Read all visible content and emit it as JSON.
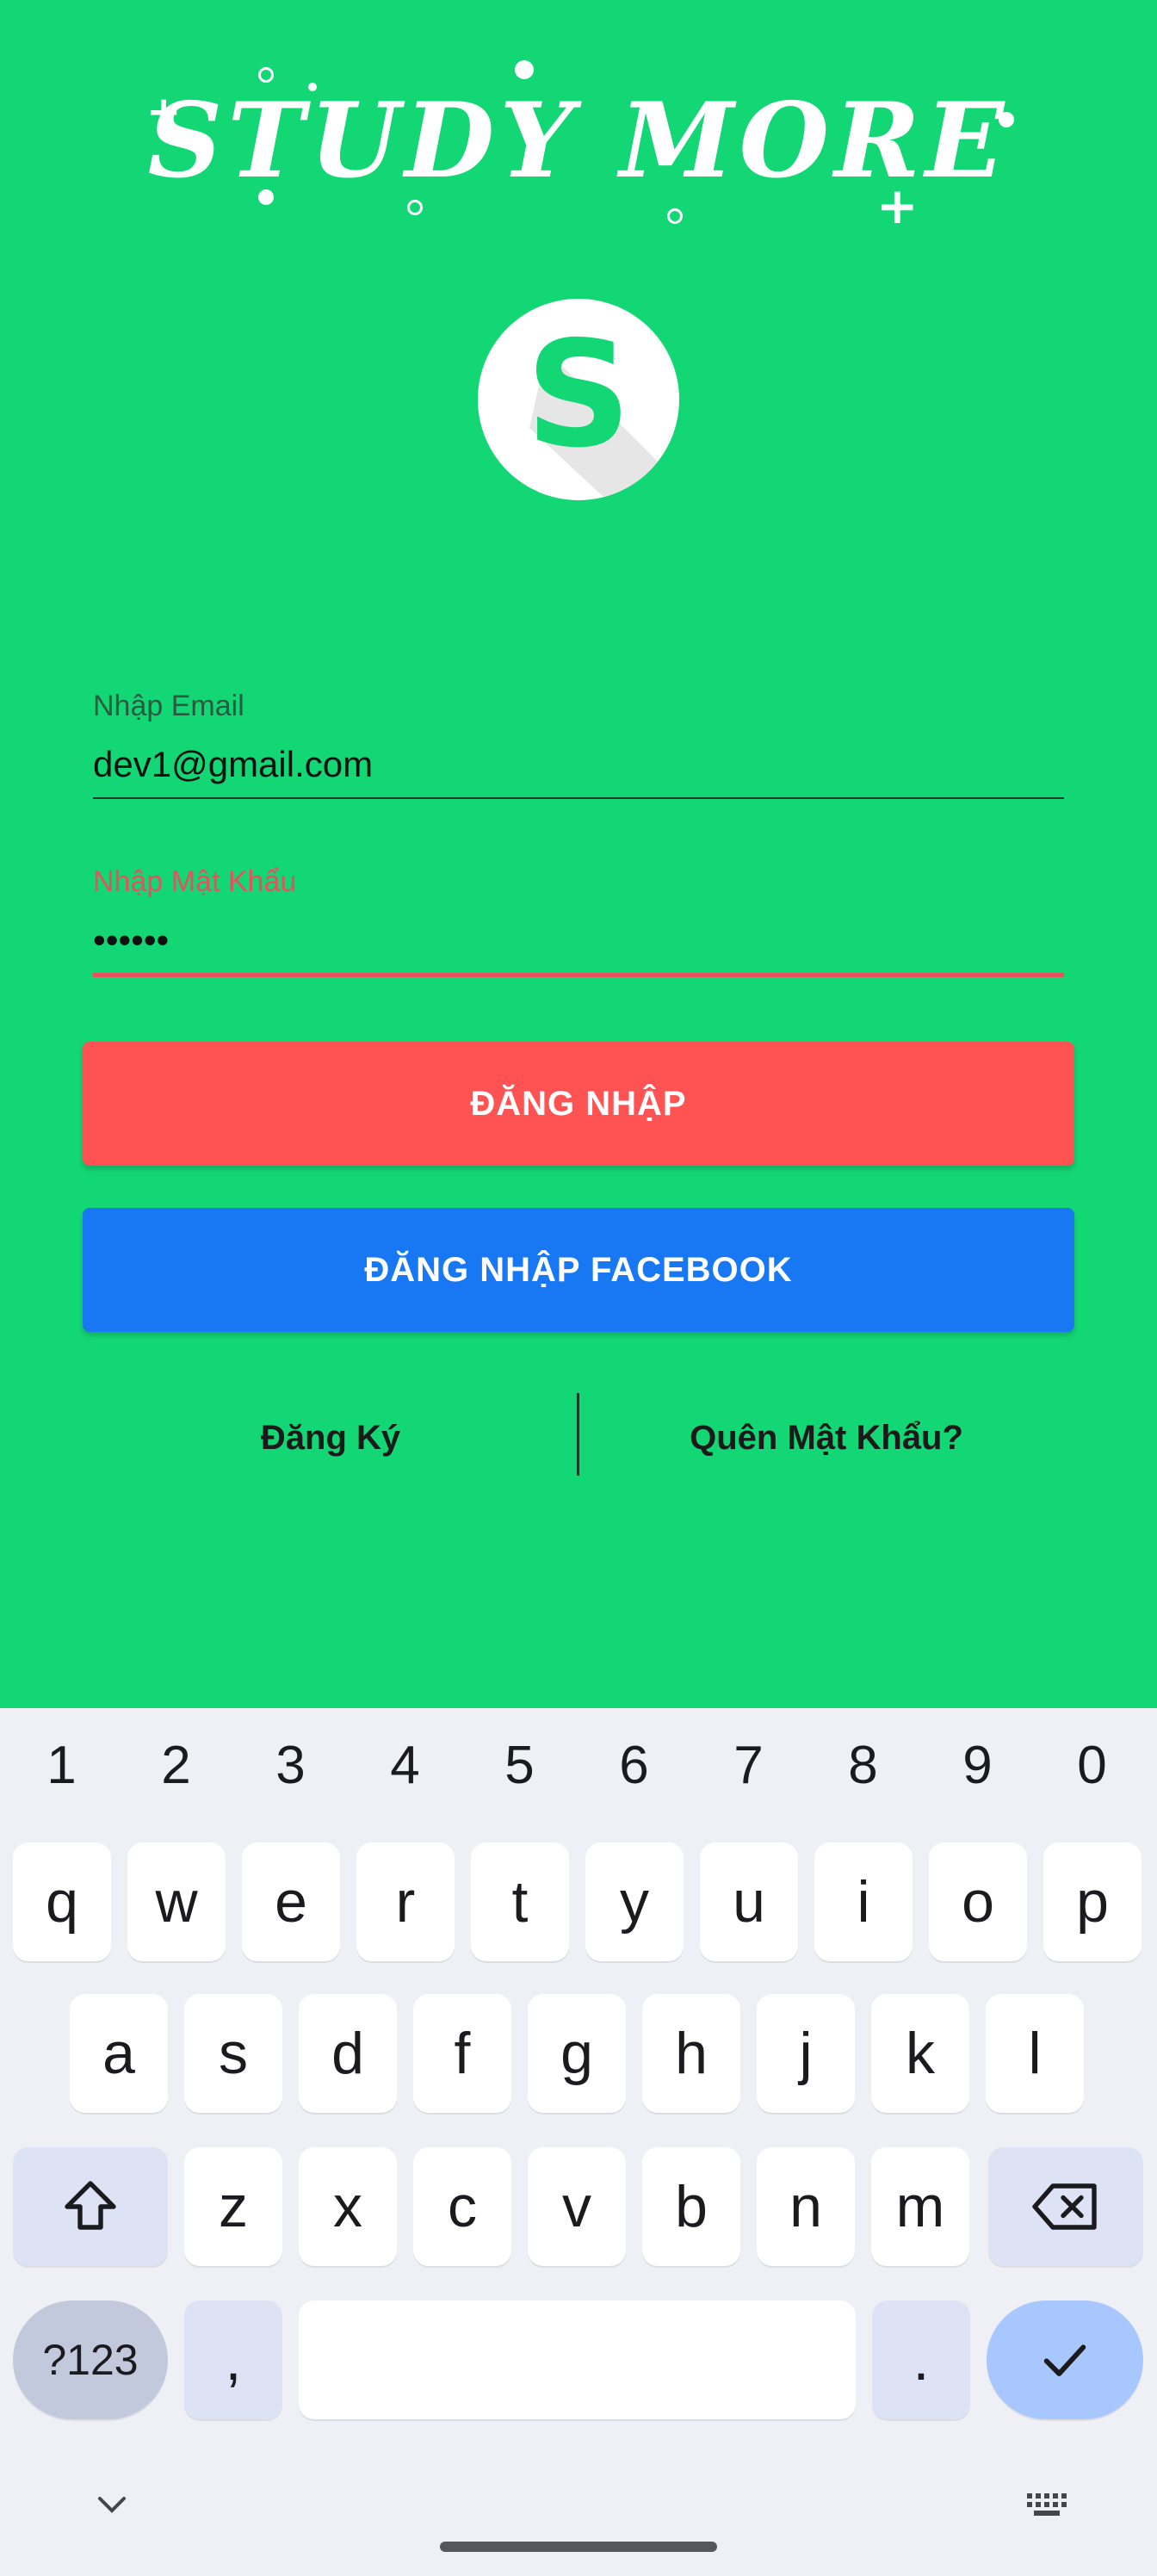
{
  "header": {
    "title": "STUDY MORE",
    "logo_letter": "S"
  },
  "form": {
    "email": {
      "label": "Nhập Email",
      "value": "dev1@gmail.com"
    },
    "password": {
      "label": "Nhập Mật Khẩu",
      "value": "••••••",
      "state": "error"
    }
  },
  "buttons": {
    "login": "ĐĂNG NHẬP",
    "facebook_login": "ĐĂNG NHẬP FACEBOOK"
  },
  "links": {
    "register": "Đăng Ký",
    "forgot_password": "Quên Mật Khẩu?"
  },
  "keyboard": {
    "number_row": [
      "1",
      "2",
      "3",
      "4",
      "5",
      "6",
      "7",
      "8",
      "9",
      "0"
    ],
    "row1": [
      "q",
      "w",
      "e",
      "r",
      "t",
      "y",
      "u",
      "i",
      "o",
      "p"
    ],
    "row2": [
      "a",
      "s",
      "d",
      "f",
      "g",
      "h",
      "j",
      "k",
      "l"
    ],
    "row3": [
      "z",
      "x",
      "c",
      "v",
      "b",
      "n",
      "m"
    ],
    "symbols_key": "?123",
    "comma_key": ",",
    "period_key": ".",
    "icons": {
      "shift": "shift-arrow",
      "backspace": "backspace",
      "enter": "checkmark",
      "hide": "chevron-down",
      "switch": "keyboard"
    }
  },
  "colors": {
    "background": "#13d675",
    "login_button": "#ff5252",
    "facebook_button": "#1877f2",
    "error": "#e8505b",
    "keyboard_bg": "#eff0f6",
    "enter_key": "#a9c7ff"
  }
}
